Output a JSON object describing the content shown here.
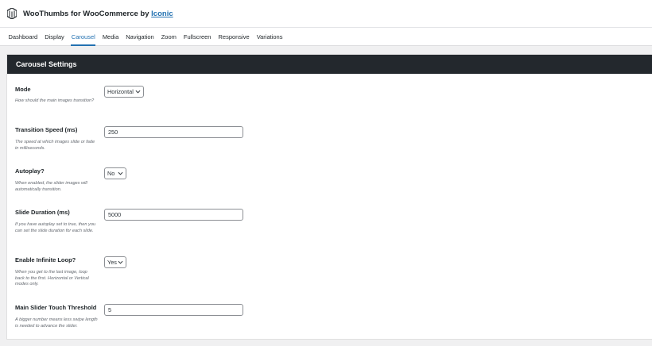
{
  "header": {
    "title_prefix": "WooThumbs for WooCommerce by ",
    "title_link": "Iconic",
    "logo_icon": "iconic-logo-icon"
  },
  "tabs": [
    {
      "label": "Dashboard",
      "active": false
    },
    {
      "label": "Display",
      "active": false
    },
    {
      "label": "Carousel",
      "active": true
    },
    {
      "label": "Media",
      "active": false
    },
    {
      "label": "Navigation",
      "active": false
    },
    {
      "label": "Zoom",
      "active": false
    },
    {
      "label": "Fullscreen",
      "active": false
    },
    {
      "label": "Responsive",
      "active": false
    },
    {
      "label": "Variations",
      "active": false
    }
  ],
  "panel": {
    "title": "Carousel Settings"
  },
  "fields": {
    "mode": {
      "label": "Mode",
      "desc": "How should the main images transition?",
      "value": "Horizontal"
    },
    "transition_speed": {
      "label": "Transition Speed (ms)",
      "desc": "The speed at which images slide or fade in milliseconds.",
      "value": "250"
    },
    "autoplay": {
      "label": "Autoplay?",
      "desc": "When enabled, the slider images will automatically transition.",
      "value": "No"
    },
    "slide_duration": {
      "label": "Slide Duration (ms)",
      "desc": "If you have autoplay set to true, then you can set the slide duration for each slide.",
      "value": "5000"
    },
    "infinite_loop": {
      "label": "Enable Infinite Loop?",
      "desc": "When you get to the last image, loop back to the first. Horizontal or Vertical modes only.",
      "value": "Yes"
    },
    "touch_threshold": {
      "label": "Main Slider Touch Threshold",
      "desc": "A bigger number means less swipe length is needed to advance the slider.",
      "value": "5"
    }
  },
  "colors": {
    "accent": "#2271b1",
    "panel_header": "#23282d",
    "background": "#f0f0f1"
  }
}
